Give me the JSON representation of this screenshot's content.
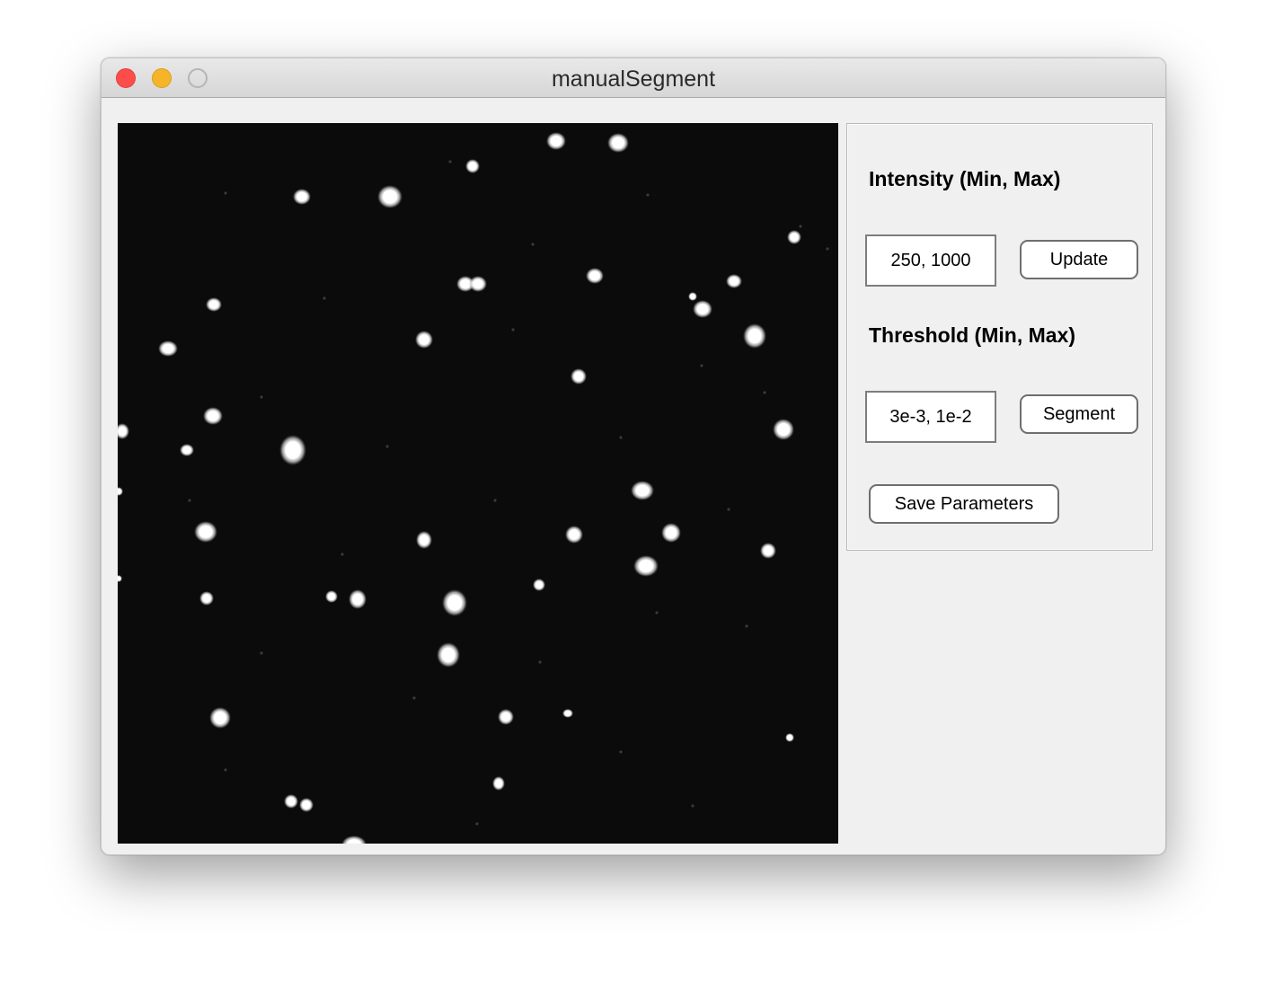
{
  "window": {
    "title": "manualSegment"
  },
  "image": {
    "description_color": "#0b0b0b",
    "spot_color": "#ffffff"
  },
  "controls": {
    "intensity_label": "Intensity (Min, Max)",
    "intensity_value": "250, 1000",
    "update_label": "Update",
    "threshold_label": "Threshold (Min, Max)",
    "threshold_value": "3e-3, 1e-2",
    "segment_label": "Segment",
    "save_label": "Save Parameters"
  },
  "colors": {
    "close": "#fc4d4b",
    "minimize": "#f6b529",
    "window_bg": "#f0f0f0"
  }
}
